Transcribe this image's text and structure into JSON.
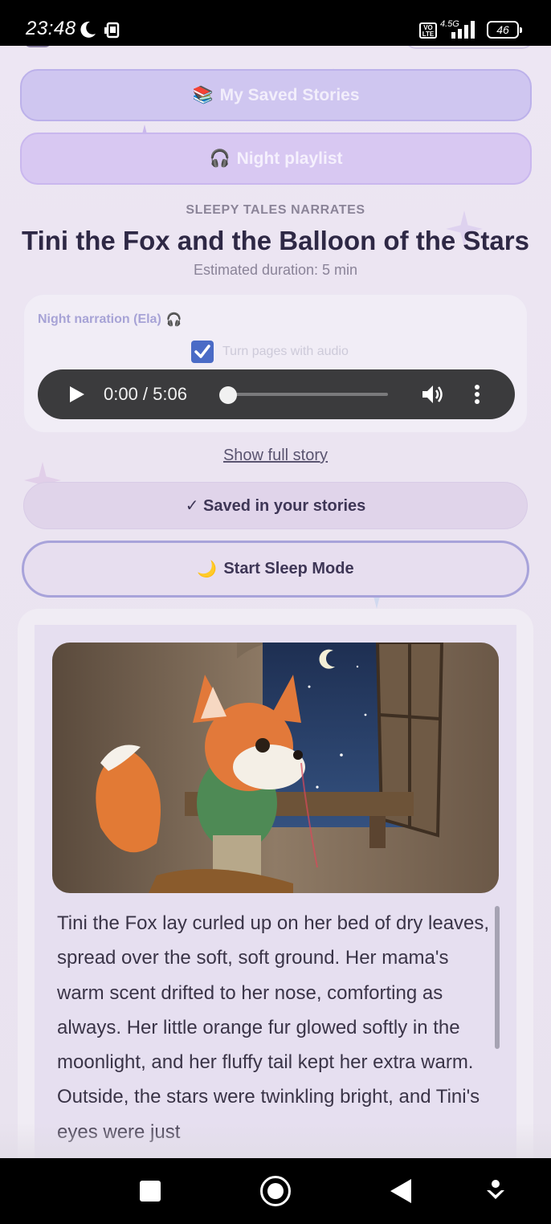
{
  "status_bar": {
    "time": "23:48",
    "network": "4.5G",
    "volte": "Vo\nLTE",
    "battery": "46"
  },
  "buttons": {
    "saved_stories_icon": "📚",
    "saved_stories_label": "My Saved Stories",
    "playlist_icon": "🎧",
    "playlist_label": "Night playlist"
  },
  "story_header": {
    "kicker": "SLEEPY TALES NARRATES",
    "title": "Tini the Fox and the Balloon of the Stars",
    "duration": "Estimated duration: 5 min"
  },
  "narration": {
    "label": "Night narration (Ela)",
    "label_icon": "🎧",
    "turn_pages_label": "Turn pages with audio",
    "turn_pages_checked": true,
    "player": {
      "time": "0:00 / 5:06",
      "progress": 0.0
    }
  },
  "actions": {
    "show_full_story": "Show full story",
    "saved_status": "✓ Saved in your stories",
    "sleep_mode_icon": "🌙",
    "sleep_mode_label": "Start Sleep Mode"
  },
  "story": {
    "illustration": "fox-at-window-illustration",
    "text": "Tini the Fox lay curled up on her bed of dry leaves, spread over the soft, soft ground. Her mama's warm scent drifted to her nose, comforting as always. Her little orange fur glowed softly in the moonlight, and her fluffy tail kept her extra warm. Outside, the stars were twinkling bright, and Tini's eyes were just"
  },
  "colors": {
    "background": "#ede6f3",
    "accent": "#4a6bc6",
    "title": "#2e2845",
    "player": "#3b3b3d"
  }
}
